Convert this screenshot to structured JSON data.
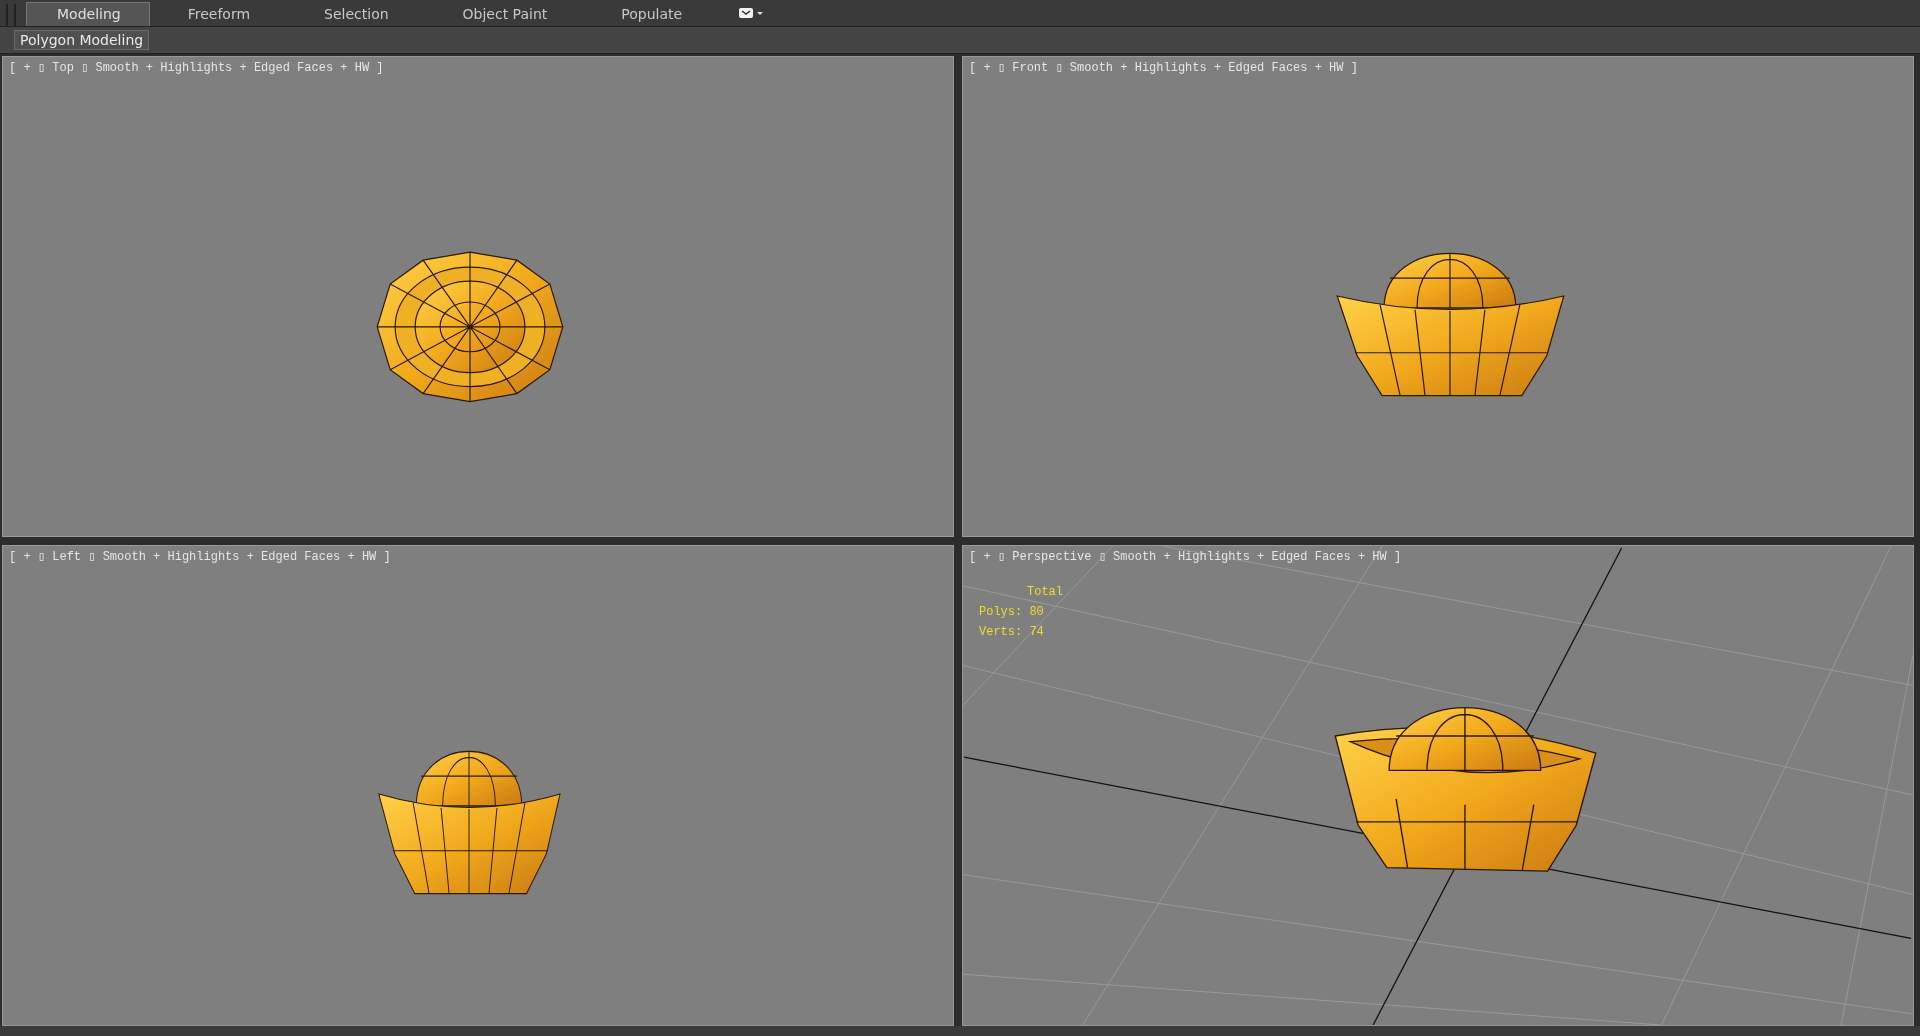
{
  "tabs": [
    {
      "label": "Modeling",
      "selected": true
    },
    {
      "label": "Freeform",
      "selected": false
    },
    {
      "label": "Selection",
      "selected": false
    },
    {
      "label": "Object Paint",
      "selected": false
    },
    {
      "label": "Populate",
      "selected": false
    }
  ],
  "ribbon": {
    "panel": "Polygon Modeling"
  },
  "viewports": [
    {
      "kind": "top",
      "label": "[ + ▯ Top ▯ Smooth + Highlights + Edged Faces + HW ]"
    },
    {
      "kind": "front",
      "label": "[ + ▯ Front ▯ Smooth + Highlights + Edged Faces + HW ]"
    },
    {
      "kind": "left",
      "label": "[ + ▯ Left ▯ Smooth + Highlights + Edged Faces + HW ]"
    },
    {
      "kind": "perspective",
      "label": "[ + ▯ Perspective ▯ Smooth + Highlights + Edged Faces + HW ]",
      "stats": {
        "title": "Total",
        "lines": [
          "Polys: 80",
          "Verts: 74"
        ]
      }
    }
  ]
}
